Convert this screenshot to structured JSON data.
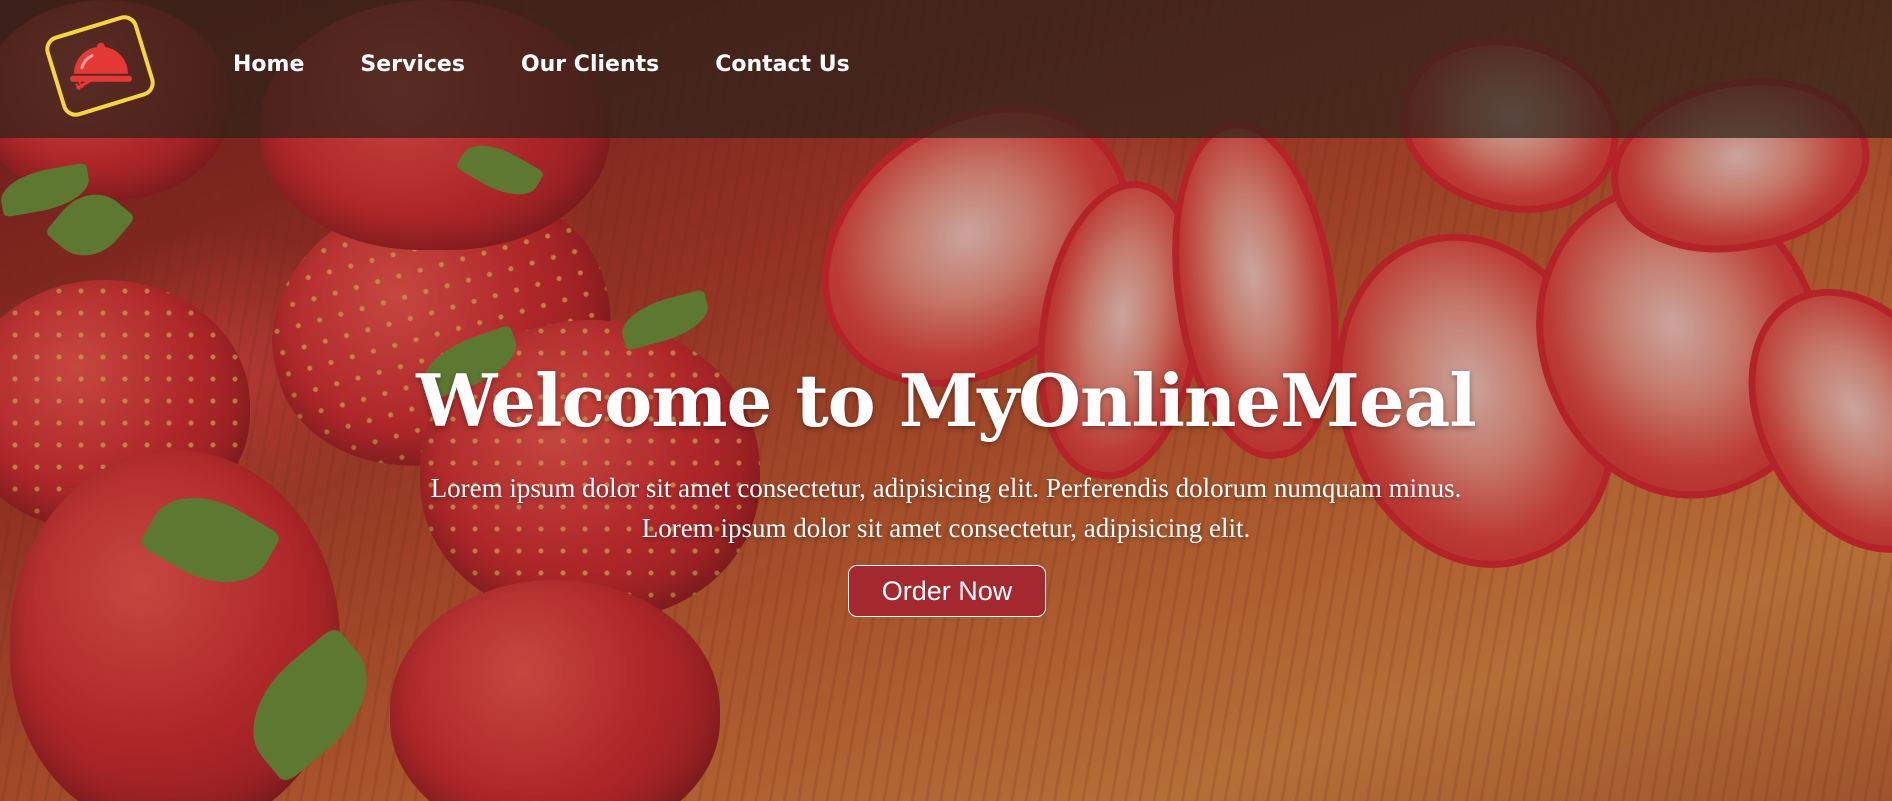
{
  "nav": {
    "logo_icon": "food-cloche-icon",
    "items": [
      {
        "label": "Home"
      },
      {
        "label": "Services"
      },
      {
        "label": "Our Clients"
      },
      {
        "label": "Contact Us"
      }
    ]
  },
  "hero": {
    "title": "Welcome to MyOnlineMeal",
    "description_line1": "Lorem ipsum dolor sit amet consectetur, adipisicing elit. Perferendis dolorum numquam minus.",
    "description_line2": "Lorem ipsum dolor sit amet consectetur, adipisicing elit.",
    "cta_label": "Order Now"
  },
  "colors": {
    "navbar_bg": "#2d2319",
    "logo_border": "#f4d83a",
    "logo_icon": "#e53935",
    "button_bg": "#a4282d",
    "text": "#ffffff"
  }
}
